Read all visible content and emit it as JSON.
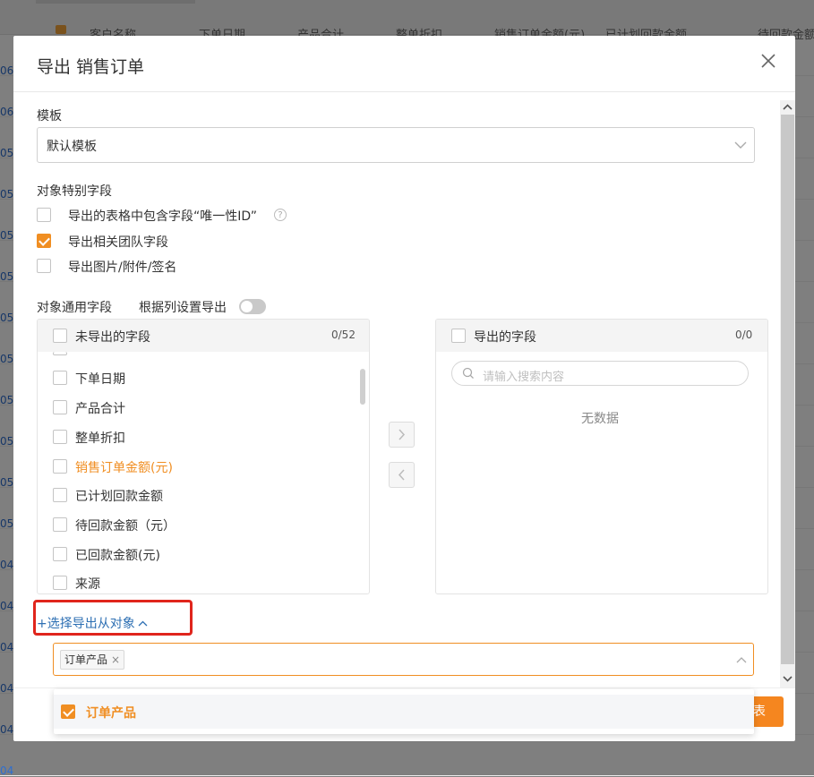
{
  "background": {
    "columns": [
      "客户名称",
      "下单日期",
      "产品合计",
      "整单折扣",
      "销售订单金额(元)",
      "已计划回款金额",
      "待回款金额"
    ],
    "row_numbers": [
      "06",
      "06",
      "05",
      "05",
      "05",
      "05",
      "05",
      "05",
      "05",
      "05",
      "05",
      "05",
      "04",
      "04",
      "04",
      "04",
      "04",
      "04"
    ]
  },
  "modal": {
    "title": "导出 销售订单",
    "template": {
      "label": "模板",
      "value": "默认模板"
    },
    "special_fields": {
      "label": "对象特别字段",
      "options": [
        {
          "text": "导出的表格中包含字段“唯一性ID”",
          "checked": false
        },
        {
          "text": "导出相关团队字段",
          "checked": true
        },
        {
          "text": "导出图片/附件/签名",
          "checked": false
        }
      ]
    },
    "common_fields": {
      "label": "对象通用字段",
      "toggle_label": "根据列设置导出",
      "toggle_on": false
    },
    "transfer": {
      "left": {
        "title": "未导出的字段",
        "count": "0/52",
        "items": [
          {
            "text": "下单日期",
            "highlight": false
          },
          {
            "text": "产品合计",
            "highlight": false
          },
          {
            "text": "整单折扣",
            "highlight": false
          },
          {
            "text": "销售订单金额(元)",
            "highlight": true
          },
          {
            "text": "已计划回款金额",
            "highlight": false
          },
          {
            "text": "待回款金额（元）",
            "highlight": false
          },
          {
            "text": "已回款金额(元)",
            "highlight": false
          },
          {
            "text": "来源",
            "highlight": false
          }
        ]
      },
      "right": {
        "title": "导出的字段",
        "count": "0/0",
        "search_placeholder": "请输入搜索内容",
        "empty_text": "无数据"
      }
    },
    "sub_objects": {
      "link_text": "+选择导出从对象",
      "selected_tags": [
        "订单产品"
      ],
      "dropdown_options": [
        {
          "text": "订单产品",
          "checked": true
        }
      ]
    },
    "primary_button_label": "表"
  },
  "colors": {
    "accent": "#f08e22",
    "link": "#2d6fb3",
    "highlight_box": "#e0251c"
  }
}
